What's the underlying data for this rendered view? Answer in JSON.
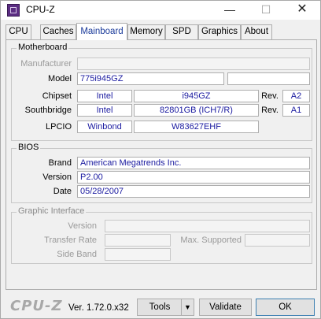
{
  "window": {
    "title": "CPU-Z",
    "min_label": "—",
    "max_label": "☐",
    "close_label": "✕"
  },
  "tabs": [
    {
      "label": "CPU"
    },
    {
      "label": "Caches"
    },
    {
      "label": "Mainboard"
    },
    {
      "label": "Memory"
    },
    {
      "label": "SPD"
    },
    {
      "label": "Graphics"
    },
    {
      "label": "About"
    }
  ],
  "active_tab": "Mainboard",
  "motherboard": {
    "title": "Motherboard",
    "manufacturer_label": "Manufacturer",
    "manufacturer_value": "",
    "model_label": "Model",
    "model_value": "775i945GZ",
    "model_extra": "",
    "chipset_label": "Chipset",
    "chipset_vendor": "Intel",
    "chipset_name": "i945GZ",
    "chipset_rev_label": "Rev.",
    "chipset_rev": "A2",
    "southbridge_label": "Southbridge",
    "southbridge_vendor": "Intel",
    "southbridge_name": "82801GB (ICH7/R)",
    "southbridge_rev_label": "Rev.",
    "southbridge_rev": "A1",
    "lpcio_label": "LPCIO",
    "lpcio_vendor": "Winbond",
    "lpcio_name": "W83627EHF"
  },
  "bios": {
    "title": "BIOS",
    "brand_label": "Brand",
    "brand_value": "American Megatrends Inc.",
    "version_label": "Version",
    "version_value": "P2.00",
    "date_label": "Date",
    "date_value": "05/28/2007"
  },
  "graphic_interface": {
    "title": "Graphic Interface",
    "version_label": "Version",
    "version_value": "",
    "transfer_rate_label": "Transfer Rate",
    "transfer_rate_value": "",
    "max_supported_label": "Max. Supported",
    "max_supported_value": "",
    "side_band_label": "Side Band",
    "side_band_value": ""
  },
  "footer": {
    "logo": "CPU-Z",
    "version": "Ver. 1.72.0.x32",
    "tools_label": "Tools",
    "dropdown_arrow": "▼",
    "validate_label": "Validate",
    "ok_label": "OK"
  }
}
